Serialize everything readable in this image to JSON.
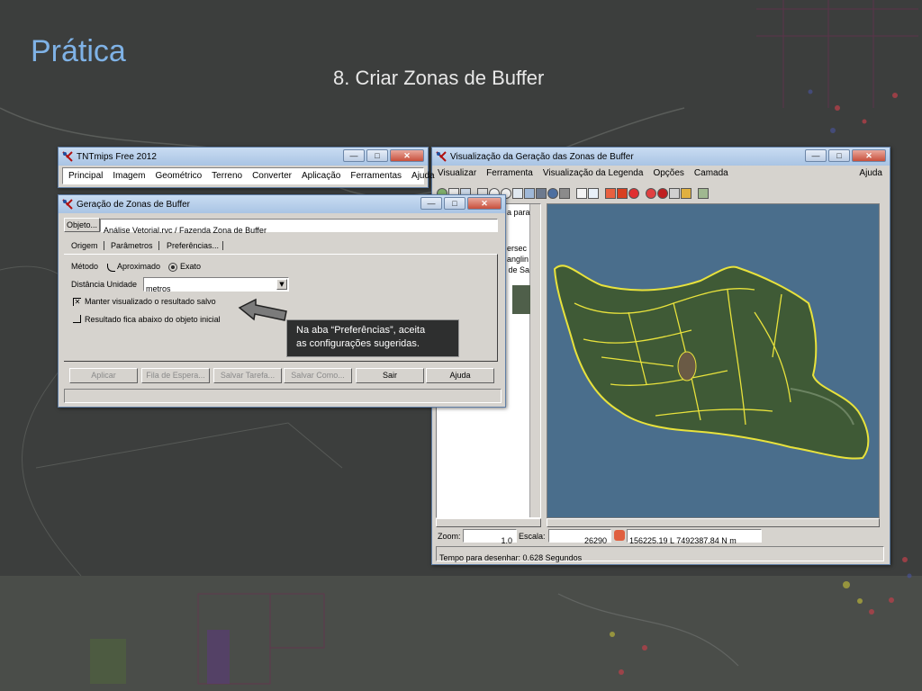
{
  "slide": {
    "title": "Prática",
    "subtitle": "8. Criar Zonas de Buffer"
  },
  "main_window": {
    "title": "TNTmips Free 2012",
    "menu": [
      "Principal",
      "Imagem",
      "Geométrico",
      "Terreno",
      "Converter",
      "Aplicação",
      "Ferramentas",
      "Ajuda"
    ]
  },
  "buffer_dialog": {
    "title": "Geração de Zonas de Buffer",
    "object_button": "Objeto...",
    "object_path": "Análise Vetorial.rvc / Fazenda Zona de Buffer",
    "tabs": [
      "Origem",
      "Parâmetros",
      "Preferências..."
    ],
    "method_label": "Método",
    "method_options": [
      "Aproximado",
      "Exato"
    ],
    "distance_unit_label": "Distância Unidade",
    "distance_unit_value": "metros",
    "checkbox_keep": "Manter visualizado o resultado salvo",
    "checkbox_keep_checked": true,
    "checkbox_below": "Resultado fica abaixo do objeto inicial",
    "checkbox_below_checked": false,
    "buttons": [
      "Aplicar",
      "Fila de Espera...",
      "Salvar Tarefa...",
      "Salvar Como...",
      "Sair",
      "Ajuda"
    ]
  },
  "viewer": {
    "title": "Visualização da Geração das Zonas de Buffer",
    "menu": [
      "Visualizar",
      "Ferramenta",
      "Visualização da Legenda",
      "Opções",
      "Camada"
    ],
    "help": "Ajuda",
    "legend_fragments": [
      "a para",
      "ersec",
      "anglin",
      "a de Sa"
    ],
    "zoom_label": "Zoom:",
    "zoom_value": "1.0",
    "scale_label": "Escala:",
    "scale_value": "26290",
    "coords": "156225.19 L  7492387.84 N m",
    "status": "Tempo para desenhar: 0.628 Segundos"
  },
  "callout": {
    "line1": "Na aba “Preferências”, aceita",
    "line2": "as configurações sugeridas."
  },
  "colors": {
    "title_accent": "#7fb2e6",
    "titlebar": "#b9d0ec",
    "window_face": "#d6d3ce",
    "water": "#4a6e8c",
    "field_lines": "#e8e23c"
  }
}
